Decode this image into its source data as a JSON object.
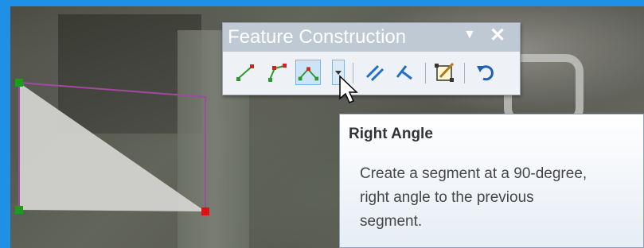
{
  "toolbar": {
    "title": "Feature Construction",
    "menu_icon": "dropdown-arrow-icon",
    "close_label": "✕",
    "tools": [
      {
        "name": "line-segment-icon",
        "tooltip": ""
      },
      {
        "name": "midpoint-icon",
        "tooltip": ""
      },
      {
        "name": "right-angle-icon",
        "active": true
      },
      {
        "name": "right-angle-dropdown-icon"
      },
      {
        "name": "parallel-icon"
      },
      {
        "name": "perpendicular-icon"
      },
      {
        "name": "trace-icon"
      },
      {
        "name": "undo-icon"
      }
    ]
  },
  "tooltip": {
    "title": "Right Angle",
    "lines": [
      "Create a segment at a 90-degree,",
      "right angle to the previous",
      "segment."
    ]
  },
  "colors": {
    "sketch_line": "#a04aa0",
    "vertex_green": "#1a9e1a",
    "vertex_red": "#e01010",
    "polygon_fill": "#d8d8d5",
    "active_tool": "#cce4f7",
    "toolbar_title": "#bfc9d4",
    "background_blue": "#1e90e6"
  }
}
